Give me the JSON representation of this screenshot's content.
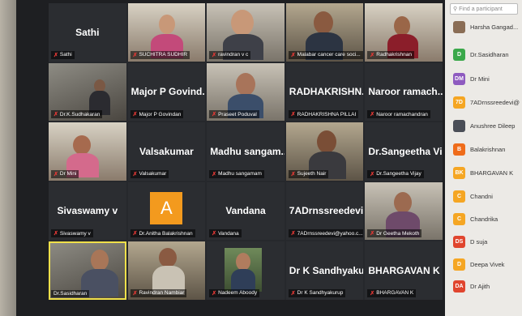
{
  "search": {
    "placeholder": "Find a participant"
  },
  "tiles": [
    {
      "center": "Sathi",
      "tag": "Sathi"
    },
    {
      "center": "",
      "tag": "SUCHITRA SUDHIR"
    },
    {
      "center": "",
      "tag": "ravindran v c"
    },
    {
      "center": "",
      "tag": "Malabar cancer care soci..."
    },
    {
      "center": "",
      "tag": "Radhakrishnan"
    },
    {
      "center": "",
      "tag": "Dr.K.Sudhakaran"
    },
    {
      "center": "Major P Govind...",
      "tag": "Major P Govindan"
    },
    {
      "center": "",
      "tag": "Praseet Poduval"
    },
    {
      "center": "RADHAKRISHN...",
      "tag": "RADHAKRISHNA PILLAI"
    },
    {
      "center": "Naroor ramach...",
      "tag": "Naroor ramachandran"
    },
    {
      "center": "",
      "tag": "Dr Mini"
    },
    {
      "center": "Valsakumar",
      "tag": "Valsakumar"
    },
    {
      "center": "Madhu sangam...",
      "tag": "Madhu sangamam"
    },
    {
      "center": "",
      "tag": "Sujeeth Nair"
    },
    {
      "center": "Dr.Sangeetha Vi...",
      "tag": "Dr.Sangeetha Vijay"
    },
    {
      "center": "Sivaswamy v",
      "tag": "Sivaswamy v"
    },
    {
      "center": "",
      "tag": "Dr.Anitha Balakrishnan",
      "avatar": "A"
    },
    {
      "center": "Vandana",
      "tag": "Vandana"
    },
    {
      "center": "7ADrnssreedevi...",
      "tag": "7ADrnssreedevi@yahoo.c..."
    },
    {
      "center": "",
      "tag": "Dr Geetha Mekoth"
    },
    {
      "center": "",
      "tag": "Dr.Sasidharan"
    },
    {
      "center": "",
      "tag": "Ravindran Nambiar"
    },
    {
      "center": "",
      "tag": "Nadeem Aboody"
    },
    {
      "center": "Dr K Sandhyaku...",
      "tag": "Dr K Sandhyakurup"
    },
    {
      "center": "BHARGAVAN K",
      "tag": "BHARGAVAN K"
    }
  ],
  "participants": [
    {
      "initials": "",
      "name": "Harsha Gangad...",
      "color": "#8a6d55"
    },
    {
      "initials": "D",
      "name": "Dr.Sasidharan",
      "color": "#3aa84a"
    },
    {
      "initials": "DM",
      "name": "Dr Mini",
      "color": "#8e5bc0"
    },
    {
      "initials": "7D",
      "name": "7ADrnssreedevi@",
      "color": "#f5a623"
    },
    {
      "initials": "",
      "name": "Anushree Dileep",
      "color": "#4a4e57"
    },
    {
      "initials": "B",
      "name": "Balakrishnan",
      "color": "#ef6c1a"
    },
    {
      "initials": "BK",
      "name": "BHARGAVAN K",
      "color": "#f5a623"
    },
    {
      "initials": "C",
      "name": "Chandni",
      "color": "#f5a623"
    },
    {
      "initials": "C",
      "name": "Chandrika",
      "color": "#f5a623"
    },
    {
      "initials": "DS",
      "name": "D suja",
      "color": "#e0452e"
    },
    {
      "initials": "D",
      "name": "Deepa Vivek",
      "color": "#f5a623"
    },
    {
      "initials": "DA",
      "name": "Dr Ajith",
      "color": "#e0452e"
    }
  ]
}
